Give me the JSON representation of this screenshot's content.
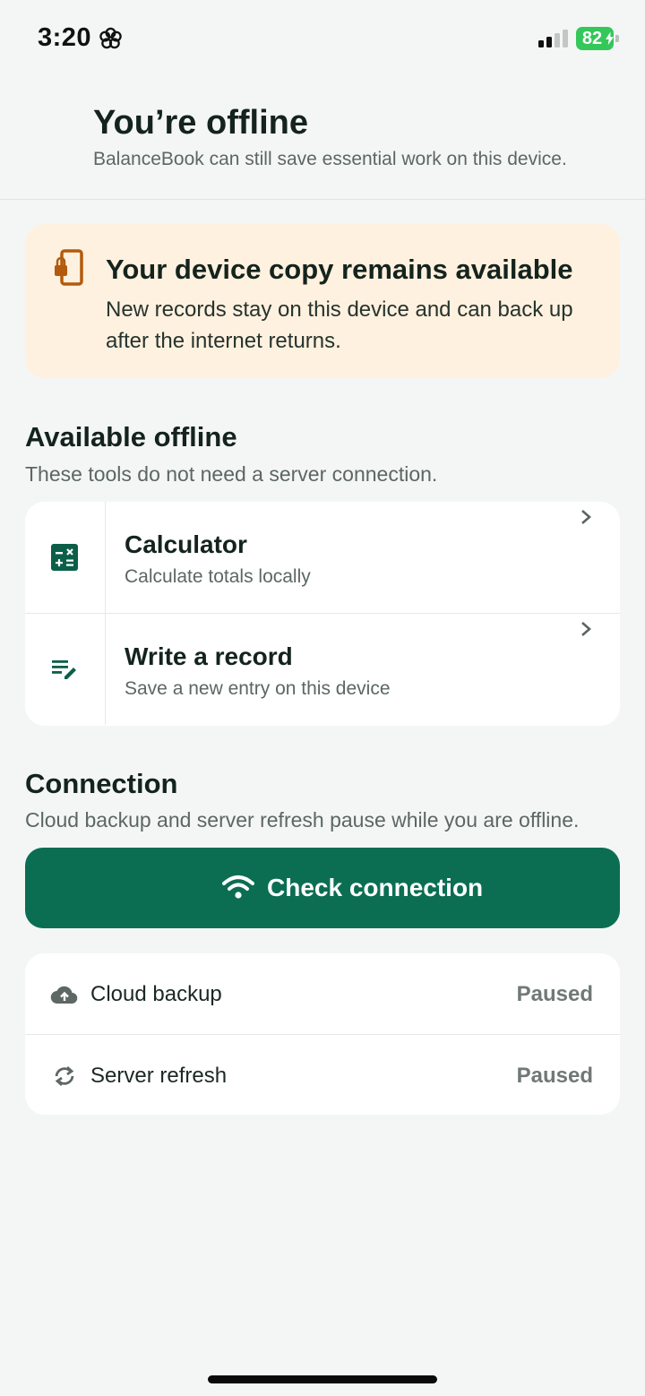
{
  "status_bar": {
    "time": "3:20",
    "battery_level": "82",
    "battery_color": "#34c759"
  },
  "header": {
    "title": "You’re offline",
    "subtitle": "BalanceBook can still save essential work on this device."
  },
  "notice": {
    "icon": "device-lock-icon",
    "title": "Your device copy remains available",
    "body": "New records stay on this device and can back up after the internet returns.",
    "background": "#fff1df"
  },
  "offline_tools": {
    "title": "Available offline",
    "subtitle": "These tools do not need a server connection.",
    "items": [
      {
        "icon": "calculator-icon",
        "title": "Calculator",
        "description": "Calculate totals locally"
      },
      {
        "icon": "edit-note-icon",
        "title": "Write a record",
        "description": "Save a new entry on this device"
      }
    ]
  },
  "connection": {
    "title": "Connection",
    "subtitle": "Cloud backup and server refresh pause while you are offline.",
    "check_button": {
      "icon": "wifi-icon",
      "label": "Check connection"
    },
    "accent": "#0b6e53",
    "statuses": [
      {
        "icon": "cloud-upload-icon",
        "label": "Cloud backup",
        "value": "Paused"
      },
      {
        "icon": "sync-icon",
        "label": "Server refresh",
        "value": "Paused"
      }
    ]
  }
}
